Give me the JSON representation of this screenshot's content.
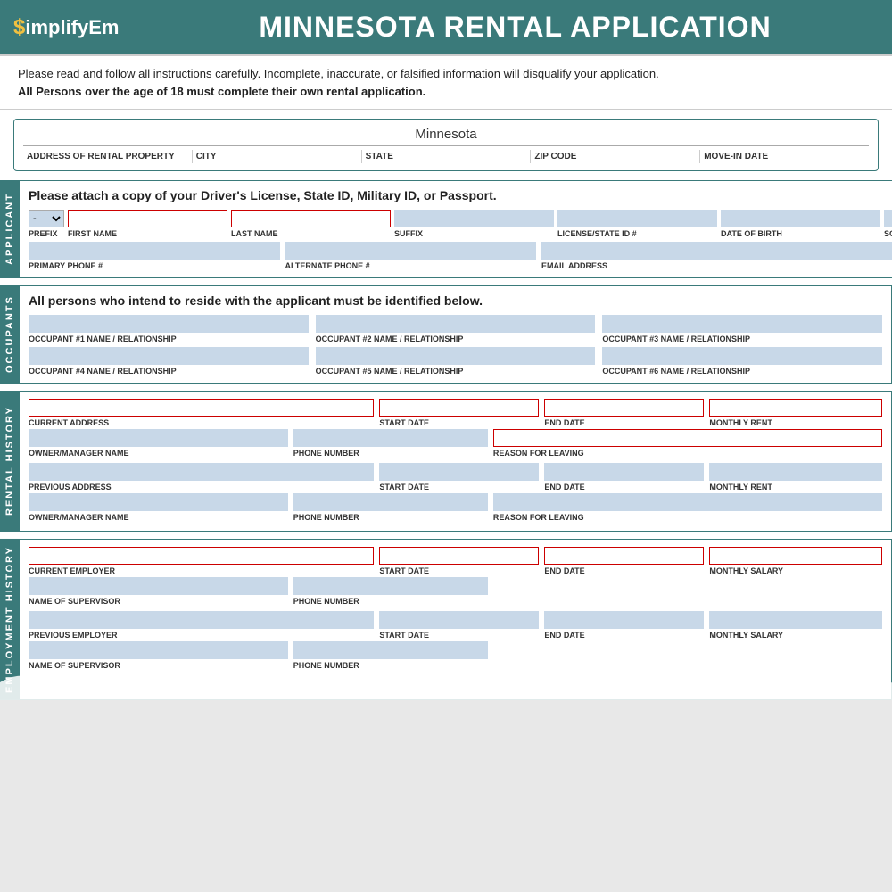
{
  "header": {
    "logo_symbol": "$",
    "logo_name": "implifyEm",
    "title": "MINNESOTA RENTAL APPLICATION"
  },
  "instruction": {
    "line1": "Please read and follow all instructions carefully. Incomplete, inaccurate, or falsified information will disqualify your application.",
    "line2": "All Persons over the age of 18 must complete their own rental application."
  },
  "property": {
    "state": "Minnesota",
    "fields": [
      "ADDRESS OF RENTAL PROPERTY",
      "CITY",
      "STATE",
      "ZIP CODE",
      "MOVE-IN DATE"
    ]
  },
  "applicant": {
    "side_label": "APPLICANT",
    "notice": "Please attach a copy of your Driver's License, State ID, Military ID, or Passport.",
    "fields_row1": {
      "prefix": "-",
      "first_name_label": "FIRST NAME",
      "last_name_label": "LAST NAME",
      "suffix_label": "SUFFIX",
      "license_label": "LICENSE/STATE ID #",
      "dob_label": "DATE OF BIRTH",
      "ssn_label": "SOCIAL SECURITY #"
    },
    "fields_row2": {
      "primary_phone_label": "PRIMARY PHONE #",
      "alt_phone_label": "ALTERNATE PHONE #",
      "email_label": "EMAIL ADDRESS"
    }
  },
  "occupants": {
    "side_label": "OCCUPANTS",
    "notice": "All persons who intend to reside with the applicant must be identified below.",
    "fields": [
      "OCCUPANT #1 NAME / RELATIONSHIP",
      "OCCUPANT #2 NAME / RELATIONSHIP",
      "OCCUPANT #3 NAME / RELATIONSHIP",
      "OCCUPANT #4 NAME / RELATIONSHIP",
      "OCCUPANT #5 NAME / RELATIONSHIP",
      "OCCUPANT #6 NAME / RELATIONSHIP"
    ]
  },
  "rental_history": {
    "side_label": "RENTAL HISTORY",
    "rows": [
      {
        "address_label": "CURRENT ADDRESS",
        "start_label": "START DATE",
        "end_label": "END DATE",
        "rent_label": "MONTHLY RENT",
        "owner_label": "OWNER/MANAGER NAME",
        "phone_label": "PHONE NUMBER",
        "reason_label": "REASON FOR LEAVING"
      },
      {
        "address_label": "PREVIOUS ADDRESS",
        "start_label": "START DATE",
        "end_label": "END DATE",
        "rent_label": "MONTHLY RENT",
        "owner_label": "OWNER/MANAGER NAME",
        "phone_label": "PHONE NUMBER",
        "reason_label": "REASON FOR LEAVING"
      }
    ]
  },
  "employment_history": {
    "side_label": "EMPLOYMENT HISTORY",
    "rows": [
      {
        "employer_label": "CURRENT EMPLOYER",
        "start_label": "START DATE",
        "end_label": "END DATE",
        "salary_label": "MONTHLY SALARY",
        "supervisor_label": "NAME OF SUPERVISOR",
        "phone_label": "PHONE NUMBER"
      },
      {
        "employer_label": "PREVIOUS EMPLOYER",
        "start_label": "START DATE",
        "end_label": "END DATE",
        "salary_label": "MONTHLY SALARY",
        "supervisor_label": "NAME OF SUPERVISOR",
        "phone_label": "PHONE NUMBER"
      }
    ]
  }
}
